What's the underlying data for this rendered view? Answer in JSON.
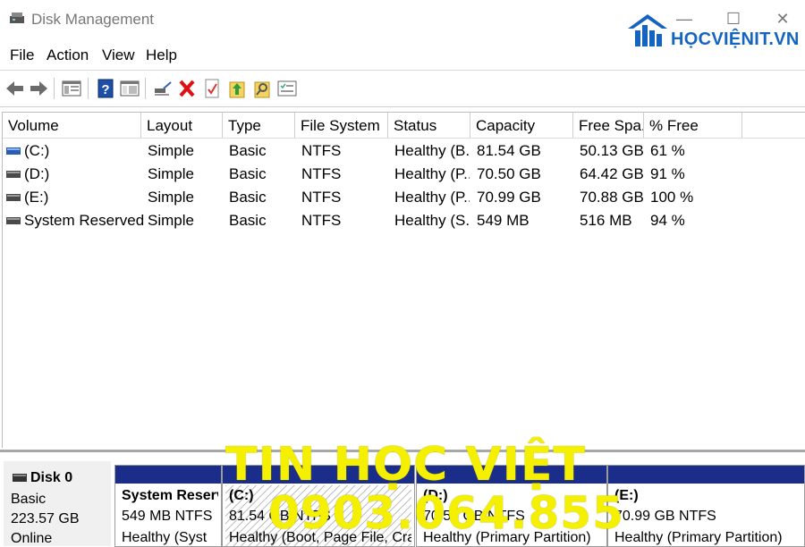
{
  "window": {
    "title": "Disk Management",
    "controls": {
      "minimize": "—",
      "maximize": "☐",
      "close": "✕"
    }
  },
  "logo": {
    "text": "HỌCVIỆNIT.VN",
    "color": "#1565c0"
  },
  "menu": [
    "File",
    "Action",
    "View",
    "Help"
  ],
  "toolbar": {
    "icons": [
      "back-arrow-icon",
      "forward-arrow-icon",
      "console-tree-icon",
      "help-icon",
      "properties-icon",
      "connect-icon",
      "delete-icon",
      "check-icon",
      "up-folder-icon",
      "open-folder-icon",
      "list-icon"
    ]
  },
  "volume_table": {
    "columns": [
      "Volume",
      "Layout",
      "Type",
      "File System",
      "Status",
      "Capacity",
      "Free Spa...",
      "% Free"
    ],
    "rows": [
      {
        "volume": "(C:)",
        "layout": "Simple",
        "type": "Basic",
        "fs": "NTFS",
        "status": "Healthy (B...",
        "capacity": "81.54 GB",
        "free": "50.13 GB",
        "pct": "61 %",
        "icon": "system-volume-icon"
      },
      {
        "volume": "(D:)",
        "layout": "Simple",
        "type": "Basic",
        "fs": "NTFS",
        "status": "Healthy (P...",
        "capacity": "70.50 GB",
        "free": "64.42 GB",
        "pct": "91 %",
        "icon": "volume-icon"
      },
      {
        "volume": "(E:)",
        "layout": "Simple",
        "type": "Basic",
        "fs": "NTFS",
        "status": "Healthy (P...",
        "capacity": "70.99 GB",
        "free": "70.88 GB",
        "pct": "100 %",
        "icon": "volume-icon"
      },
      {
        "volume": "System Reserved",
        "layout": "Simple",
        "type": "Basic",
        "fs": "NTFS",
        "status": "Healthy (S...",
        "capacity": "549 MB",
        "free": "516 MB",
        "pct": "94 %",
        "icon": "volume-icon"
      }
    ]
  },
  "disk_map": {
    "disk": {
      "name": "Disk 0",
      "kind": "Basic",
      "size": "223.57 GB",
      "state": "Online"
    },
    "partitions": [
      {
        "title": "System Reserve",
        "size": "549 MB NTFS",
        "status": "Healthy (Syst"
      },
      {
        "title": "(C:)",
        "size": "81.54 GB NTFS",
        "status": "Healthy (Boot, Page File, Crash"
      },
      {
        "title": "(D:)",
        "size": "70.50 GB NTFS",
        "status": "Healthy (Primary Partition)"
      },
      {
        "title": "(E:)",
        "size": "70.99 GB NTFS",
        "status": "Healthy (Primary Partition)"
      }
    ],
    "bar_color": "#1b2d8a"
  },
  "watermark": {
    "line1": "TIN HỌC VIỆT",
    "line2": "0903.064.855",
    "color": "#f4f000"
  }
}
